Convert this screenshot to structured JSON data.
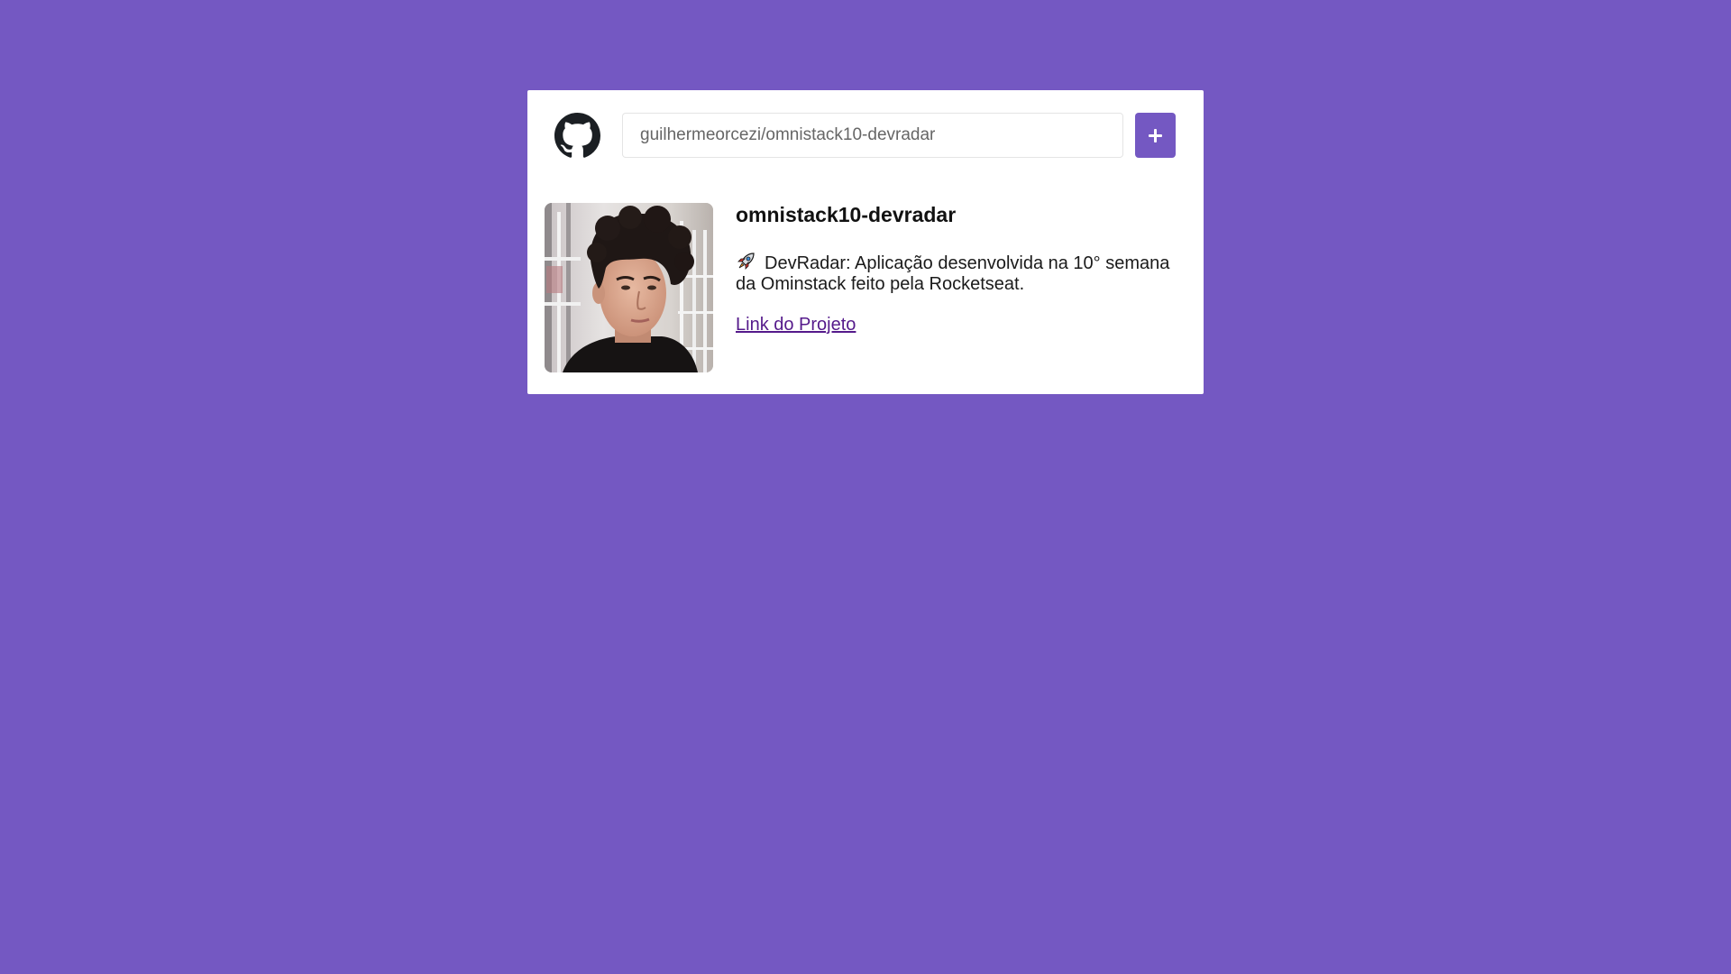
{
  "search": {
    "value": "guilhermeorcezi/omnistack10-devradar",
    "add_button_icon": "plus-icon"
  },
  "header": {
    "logo_icon": "github-icon"
  },
  "repository": {
    "name": "omnistack10-devradar",
    "description_icon": "rocket-icon",
    "description": "DevRadar: Aplicação desenvolvida na 10° semana da Ominstack feito pela Rocketseat.",
    "link_label": "Link do Projeto",
    "avatar_icon": "user-avatar"
  },
  "colors": {
    "background": "#7458c2",
    "accent": "#7458c2",
    "card": "#ffffff",
    "link": "#551a8b"
  }
}
